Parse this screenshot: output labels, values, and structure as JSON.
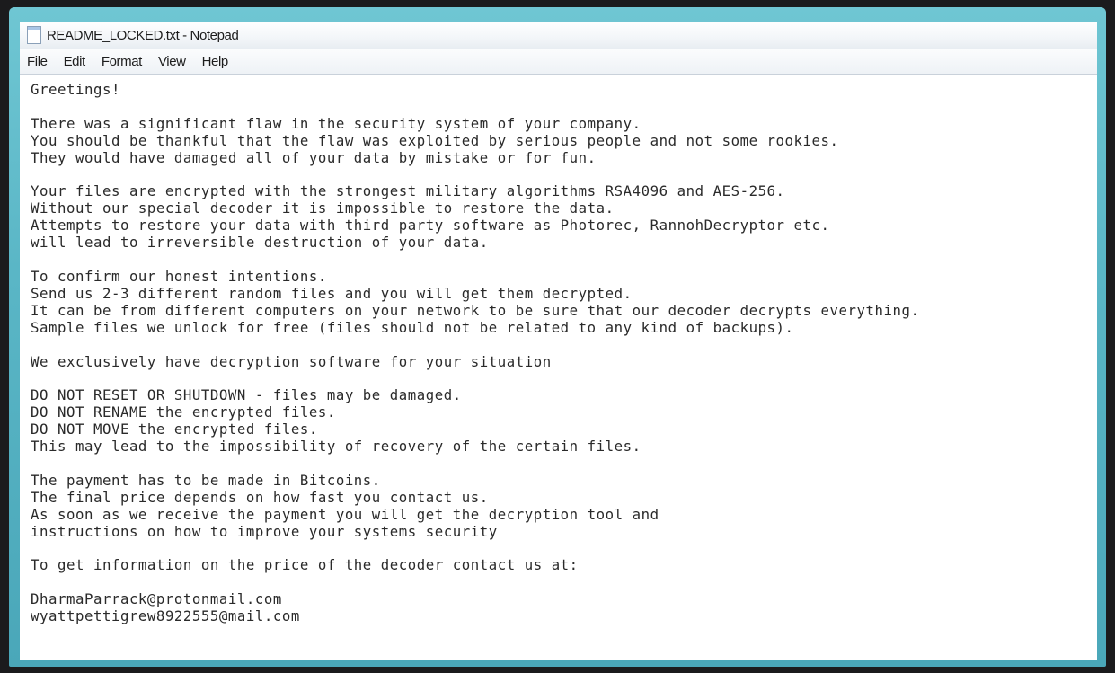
{
  "window": {
    "title": "README_LOCKED.txt - Notepad"
  },
  "menu": {
    "items": [
      "File",
      "Edit",
      "Format",
      "View",
      "Help"
    ]
  },
  "document": {
    "text": "Greetings!\n\nThere was a significant flaw in the security system of your company.\nYou should be thankful that the flaw was exploited by serious people and not some rookies.\nThey would have damaged all of your data by mistake or for fun.\n\nYour files are encrypted with the strongest military algorithms RSA4096 and AES-256.\nWithout our special decoder it is impossible to restore the data.\nAttempts to restore your data with third party software as Photorec, RannohDecryptor etc.\nwill lead to irreversible destruction of your data.\n\nTo confirm our honest intentions.\nSend us 2-3 different random files and you will get them decrypted.\nIt can be from different computers on your network to be sure that our decoder decrypts everything.\nSample files we unlock for free (files should not be related to any kind of backups).\n\nWe exclusively have decryption software for your situation\n\nDO NOT RESET OR SHUTDOWN - files may be damaged.\nDO NOT RENAME the encrypted files.\nDO NOT MOVE the encrypted files.\nThis may lead to the impossibility of recovery of the certain files.\n\nThe payment has to be made in Bitcoins.\nThe final price depends on how fast you contact us.\nAs soon as we receive the payment you will get the decryption tool and\ninstructions on how to improve your systems security\n\nTo get information on the price of the decoder contact us at:\n\nDharmaParrack@protonmail.com\nwyattpettigrew8922555@mail.com"
  }
}
